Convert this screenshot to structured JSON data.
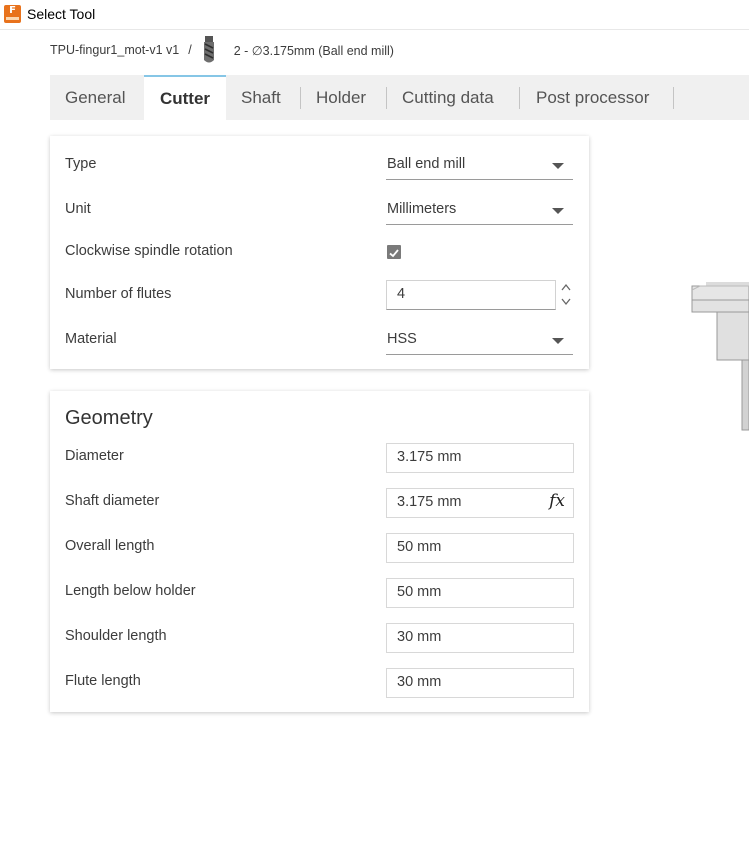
{
  "window": {
    "title": "Select Tool",
    "app_icon_letter": "F"
  },
  "breadcrumb": {
    "document": "TPU-fingur1_mot-v1 v1",
    "separator": "/",
    "tool": "2 - ∅3.175mm (Ball end mill)"
  },
  "tabs": [
    "General",
    "Cutter",
    "Shaft",
    "Holder",
    "Cutting data",
    "Post processor"
  ],
  "active_tab": "Cutter",
  "cutter": {
    "type_label": "Type",
    "type_value": "Ball end mill",
    "unit_label": "Unit",
    "unit_value": "Millimeters",
    "clockwise_label": "Clockwise spindle rotation",
    "clockwise_checked": true,
    "flutes_label": "Number of flutes",
    "flutes_value": "4",
    "material_label": "Material",
    "material_value": "HSS"
  },
  "geometry": {
    "title": "Geometry",
    "diameter_label": "Diameter",
    "diameter_value": "3.175 mm",
    "shaft_diameter_label": "Shaft diameter",
    "shaft_diameter_value": "3.175 mm",
    "overall_length_label": "Overall length",
    "overall_length_value": "50 mm",
    "length_below_holder_label": "Length below holder",
    "length_below_holder_value": "50 mm",
    "shoulder_length_label": "Shoulder length",
    "shoulder_length_value": "30 mm",
    "flute_length_label": "Flute length",
    "flute_length_value": "30 mm",
    "fx_label": "fx"
  },
  "colors": {
    "app_icon": "#e8721c",
    "active_tab_accent": "#86c6e6",
    "tab_bar_bg": "#f0f0f0"
  }
}
